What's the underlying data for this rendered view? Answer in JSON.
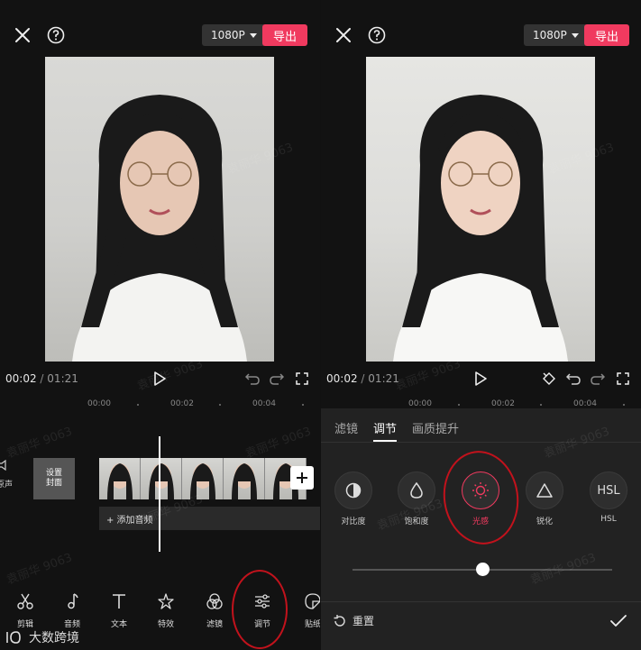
{
  "left": {
    "resolution": "1080P",
    "export_label": "导出",
    "time_current": "00:02",
    "time_sep": "/",
    "time_total": "01:21",
    "ruler": [
      "00:00",
      "00:02",
      "00:04"
    ],
    "track": {
      "audio_label": "原声",
      "cover_label": "设置\n封面",
      "add_audio": "+ 添加音频"
    },
    "tools": [
      {
        "label": "剪辑",
        "icon": "scissors-icon"
      },
      {
        "label": "音频",
        "icon": "music-note-icon"
      },
      {
        "label": "文本",
        "icon": "text-icon"
      },
      {
        "label": "特效",
        "icon": "sparkle-star-icon"
      },
      {
        "label": "滤镜",
        "icon": "filter-circles-icon"
      },
      {
        "label": "调节",
        "icon": "sliders-icon"
      },
      {
        "label": "贴纸",
        "icon": "sticker-icon"
      }
    ]
  },
  "right": {
    "resolution": "1080P",
    "export_label": "导出",
    "time_current": "00:02",
    "time_sep": "/",
    "time_total": "01:21",
    "ruler": [
      "00:00",
      "00:02",
      "00:04"
    ],
    "tabs": [
      "滤镜",
      "调节",
      "画质提升"
    ],
    "active_tab": "调节",
    "adjust_items": [
      {
        "label": "对比度",
        "icon": "contrast-icon"
      },
      {
        "label": "饱和度",
        "icon": "droplet-icon"
      },
      {
        "label": "光感",
        "icon": "sun-icon"
      },
      {
        "label": "锐化",
        "icon": "triangle-icon"
      },
      {
        "label": "HSL",
        "icon": "hsl-text-icon",
        "glyph": "HSL"
      }
    ],
    "active_adjust": "光感",
    "slider_value": 0.5,
    "reset_label": "重置"
  },
  "watermark": "袁丽华 9063",
  "logo_text": "大数跨境",
  "colors": {
    "accent": "#f03a5f",
    "annotation": "#c2121c",
    "bg": "#121212"
  }
}
